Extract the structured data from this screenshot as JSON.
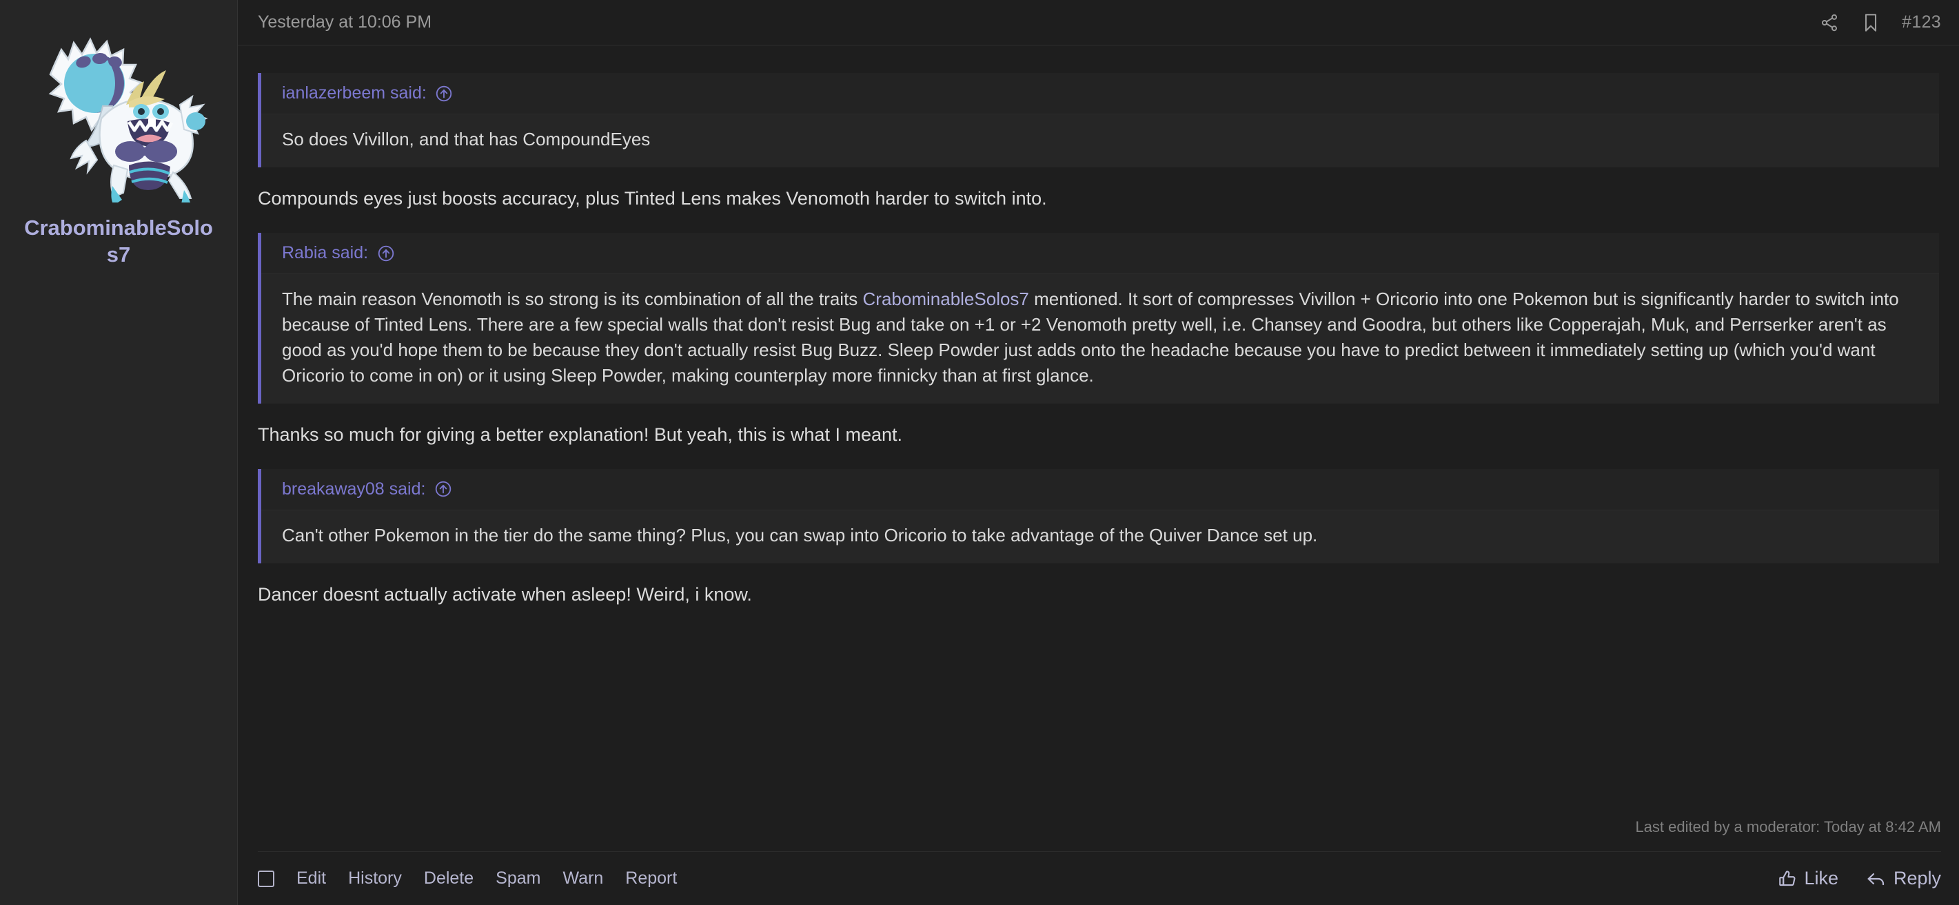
{
  "post": {
    "date": "Yesterday at 10:06 PM",
    "number": "#123",
    "share_icon": "share-icon",
    "bookmark_icon": "bookmark-icon"
  },
  "author": {
    "username": "CrabominableSolos7",
    "avatar_alt": "crabominable-avatar"
  },
  "blocks": [
    {
      "type": "quote",
      "attribution": "ianlazerbeem said:",
      "jump_icon": "jump-to-quote-icon",
      "text": "So does Vivillon, and that has CompoundEyes"
    },
    {
      "type": "paragraph",
      "text": "Compounds eyes just boosts accuracy, plus Tinted Lens makes Venomoth harder to switch into."
    },
    {
      "type": "quote",
      "attribution": "Rabia said:",
      "jump_icon": "jump-to-quote-icon",
      "text_before_mention": "The main reason Venomoth is so strong is its combination of all the traits ",
      "mention": "CrabominableSolos7",
      "text_after_mention": " mentioned. It sort of compresses Vivillon + Oricorio into one Pokemon but is significantly harder to switch into because of Tinted Lens. There are a few special walls that don't resist Bug and take on +1 or +2 Venomoth pretty well, i.e. Chansey and Goodra, but others like Copperajah, Muk, and Perrserker aren't as good as you'd hope them to be because they don't actually resist Bug Buzz. Sleep Powder just adds onto the headache because you have to predict between it immediately setting up (which you'd want Oricorio to come in on) or it using Sleep Powder, making counterplay more finnicky than at first glance."
    },
    {
      "type": "paragraph",
      "text": "Thanks so much for giving a better explanation! But yeah, this is what I meant."
    },
    {
      "type": "quote",
      "attribution": "breakaway08 said:",
      "jump_icon": "jump-to-quote-icon",
      "text": "Can't other Pokemon in the tier do the same thing? Plus, you can swap into Oricorio to take advantage of the Quiver Dance set up."
    },
    {
      "type": "paragraph",
      "text": "Dancer doesnt actually activate when asleep! Weird, i know."
    }
  ],
  "footer": {
    "last_edited": "Last edited by a moderator: Today at 8:42 AM",
    "select_checkbox": "",
    "actions": [
      {
        "label": "Edit"
      },
      {
        "label": "History"
      },
      {
        "label": "Delete"
      },
      {
        "label": "Spam"
      },
      {
        "label": "Warn"
      },
      {
        "label": "Report"
      }
    ],
    "like_label": "Like",
    "reply_label": "Reply",
    "like_icon": "thumbs-up-icon",
    "reply_icon": "reply-arrow-icon"
  },
  "colors": {
    "accent_quote_bar": "#6a64c4",
    "link": "#aeaede",
    "quote_attribution": "#7c78d0",
    "page_bg": "#1e1e1e",
    "sidebar_bg": "#262626"
  }
}
